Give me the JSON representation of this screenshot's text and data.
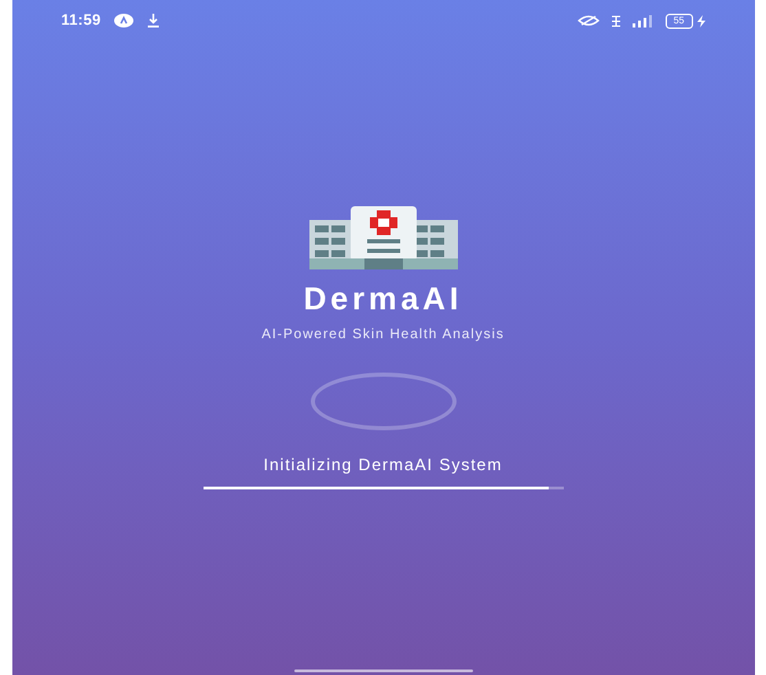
{
  "status_bar": {
    "time": "11:59",
    "battery": "55"
  },
  "app": {
    "name": "DermaAI",
    "tagline": "AI-Powered Skin Health Analysis"
  },
  "loading": {
    "message": "Initializing DermaAI System",
    "level": 0.96
  }
}
